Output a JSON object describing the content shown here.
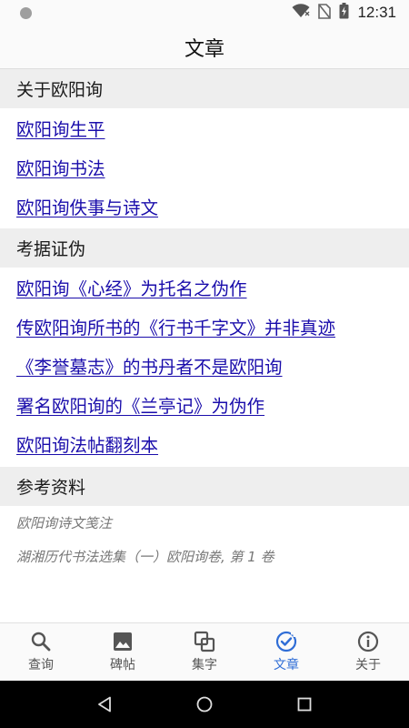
{
  "status_bar": {
    "time": "12:31"
  },
  "app_bar": {
    "title": "文章"
  },
  "sections": {
    "about": {
      "header": "关于欧阳询",
      "links": [
        "欧阳询生平",
        "欧阳询书法",
        "欧阳询佚事与诗文"
      ]
    },
    "evidence": {
      "header": "考据证伪",
      "links": [
        "欧阳询《心经》为托名之伪作",
        "传欧阳询所书的《行书千字文》并非真迹",
        "《李誉墓志》的书丹者不是欧阳询",
        "署名欧阳询的《兰亭记》为伪作",
        "欧阳询法帖翻刻本"
      ]
    },
    "references": {
      "header": "参考资料",
      "items": [
        "欧阳询诗文笺注",
        "湖湘历代书法选集（一）欧阳询卷, 第 1 卷"
      ]
    }
  },
  "bottom_nav": {
    "items": [
      {
        "label": "查询",
        "icon": "search-icon"
      },
      {
        "label": "碑帖",
        "icon": "image-icon"
      },
      {
        "label": "集字",
        "icon": "collage-icon"
      },
      {
        "label": "文章",
        "icon": "check-circle-icon",
        "active": true
      },
      {
        "label": "关于",
        "icon": "info-icon"
      }
    ]
  },
  "colors": {
    "link": "#1a0dab",
    "active_tab": "#2f6dd6",
    "section_bg": "#eeeeee"
  }
}
